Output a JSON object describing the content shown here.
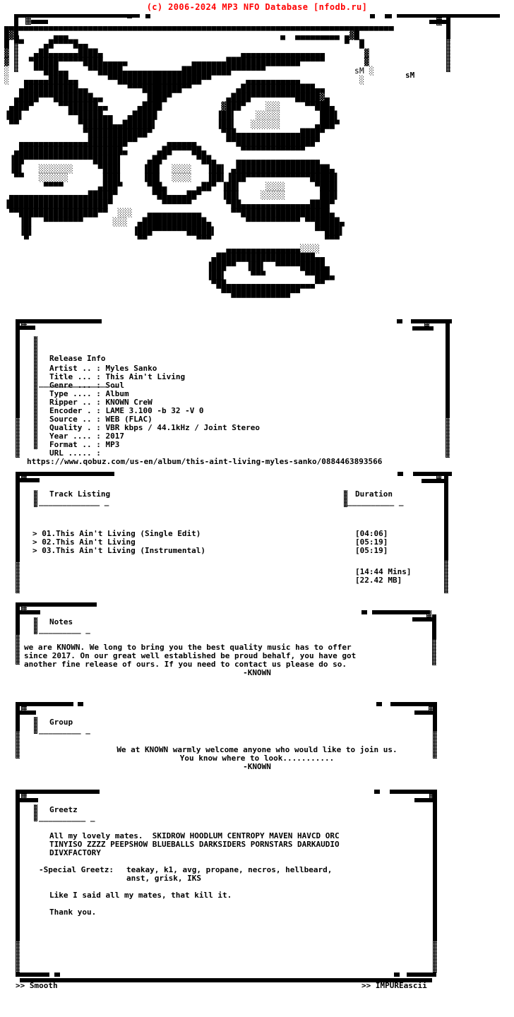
{
  "header": {
    "copyright": "(c) 2006-2024 MP3 NFO Database [nfodb.ru]",
    "color": "#ff0000"
  },
  "logo": {
    "artist_signature": "sM",
    "group_name": "KnoWn",
    "description": "ascii-art-graffiti-logo-known",
    "art": "▄▄▄▄▄▄▄▄▄▄▄▄▄▄▄▄▄▄▄▄▄▄▄▄▄▄▄▄▄▄▄▄▄▄▄▄▄▄▄▄▄▄▄▄▄▄▄▄▄▄▄▄▄▄▄▄▄▄▄▄▄▄▄▄▄▄▄▄▄▄▄▄▄▄▄▄▄▄▄\n█▓▄       ▄▄▄                                           ▄  ▄▄▄▄▄▄▄▄▄ ▄▓█\n█ ▀▀    ▄█▀▀▀▀█▄▄                                                    ▀  █\n▓     ▄██▄▄▄▄▄▄████▄                            ▄▄▄▄▄▄▄▄▄▄▄▄▄▄▄▄▄        ▓\n▓    ▀█████▀▀▀▀▀████▄▄▄▄▄             ▄▄▄▄▄▄▄███████████████▀▀▀▀▀        ▓\n░     ▀▀███▄▄    ▀▀█████▄▄▄▄▄▄▄▄▄▄▄▄██████████▀▀▀▀▀▀▀                  sM ░\n░   ▄▄▄▄▄████▄▄      ▀▀█████████████████▀▀       ▄▄▄▄▄▄▄▄▄▄▄            ░\n   ▄███████████▄▄        ▀▀▀████████▀▀         ▄███████████████▄▄\n  ▄████▀▀▀████████▄▄         ████▀           ▄████▀▀▀▀▀▀▀▀▀█████▓▄\n ▄███▀     ▀▀██████▄▄      ▄████            ▓███▀    ░░░     ▀▀███▄\n▐██▌         ▀▀█████▄▄   ▄█████            ▐██▌    ░░░░░        ███▌\n ▀▀            ▀██████▄▄██████▌            ▐██▌   ░░░░░░       ▄███▀\n                ▀████████████▀              ▀██▄▄▄▄▄▄▄▄▄▄▄▄▄████▀\n   ▄▄▄▄▄▄▄▄▄▄▄▄▄▄████████▀▀      ▄▄▄▄▄▄      ▀▀████████████████▀\n  ▄█████████████████████▄      ▄██▀▀▀▀██▄       ▀▀▀▀▀▀▀▀▀▀▀▀▀\n ▐██▀▀▀▀▀▀▀▀▀▀▀▀▀▀█████▌     ▄██▀      ▀██▄    ▄▄▄▄▄▄▄▄▄▄▄▄▄▄▄▄▄\n ▐█▌   ░░░░░░░     ▀███▌    ▐██▌  ░░░░   ▐██▌ ▄███████████████████▄\n  ▀▀   ░░░░░░       ███▌    ▐██▌  ░░░░   ▐██▌▐███▀▀▀▀▀▀▀▀▀▀▀▀▀█████▌\n        ▀▀▀▀       ▄███▀     ▀██▄      ▄██▀ ▐██▌     ░░░░      ▀███▌\n ▄▄▄▄▄▄▄▄▄▄▄▄▄▄▄▄█████▀       ▀██▄▄▄▄██▀    ▐██▌    ░░░░░       ███▌\n▐████████████████████▀          ▀▀▀▀▀▀       ▀██▄▄▄▄▄▄▄▄▄▄▄▄▄▄████▀\n ▀▀████████████████▀▀  ░░░   ▄▄▄▄▄▄▄▄▄▄▄      ▀▀██████████████████▄\n   ▐█▌  ▀▀▀▀▀▀▀▀      ░░░  ▄█████████████▄       ▀▀▀▀▀▀▀▀▀▀▀ ▀▀█████▄\n   ▐█▌                    ▐███▀▀▀▀▀▀▀█████▌                    ▀▀███▌\n    ▀                      ▀▀          ▀▀▀                       ▀▀▀\n                                             ▄▄▄▄▄▄▄▄▄▄▄▄▄▄▄░░░░\n                                          ▄████████████████████▄▄\n                                         ▐███▀▀  ▐██▌  ▀▀▀▀▀█████▄\n                                         ▐██▌     ▀▀▀        ▀▀███▄\n                                          ▀██▄▄▄▄▄▄▄▄▄▄▄▄▄▄▄▄▄▄▀▀\n                                            ▀▀████████████▀▀"
  },
  "release_info": {
    "title": "Release Info",
    "underline": "_______________ _",
    "fields": [
      {
        "label": "Artist .. :",
        "value": "Myles Sanko"
      },
      {
        "label": "Title ... :",
        "value": "This Ain't Living"
      },
      {
        "label": "Genre ... :",
        "value": "Soul"
      },
      {
        "label": "Type .... :",
        "value": "Album"
      },
      {
        "label": "Ripper .. :",
        "value": "KNOWN CreW"
      },
      {
        "label": "Encoder . :",
        "value": "LAME 3.100 -b 32 -V 0"
      },
      {
        "label": "Source .. :",
        "value": "WEB (FLAC)"
      },
      {
        "label": "Quality . :",
        "value": "VBR kbps / 44.1kHz / Joint Stereo"
      },
      {
        "label": "Year .... :",
        "value": "2017"
      },
      {
        "label": "Format .. :",
        "value": "MP3"
      },
      {
        "label": "URL ..... :",
        "value": ""
      }
    ],
    "url": "https://www.qobuz.com/us-en/album/this-aint-living-myles-sanko/0884463893566"
  },
  "track_listing": {
    "title": "Track Listing",
    "underline": "_____________ _",
    "duration_title": "Duration",
    "duration_underline": "__________ _",
    "tracks": [
      {
        "marker": ">",
        "number": "01.",
        "name": "This Ain't Living (Single Edit)",
        "duration": "[04:06]"
      },
      {
        "marker": ">",
        "number": "02.",
        "name": "This Ain't Living",
        "duration": "[05:19]"
      },
      {
        "marker": ">",
        "number": "03.",
        "name": "This Ain't Living (Instrumental)",
        "duration": "[05:19]"
      }
    ],
    "total_time": "[14:44 Mins]",
    "total_size": "[22.42 MB]"
  },
  "notes": {
    "title": "Notes",
    "underline": "_________ _",
    "lines": [
      "we are KNOWN. We long to bring you the best quality music has to offer",
      "since 2017. On our great well established be proud behalf, you have got",
      "another fine release of ours. If you need to contact us please do so."
    ],
    "signature": "-KNOWN"
  },
  "group": {
    "title": "Group",
    "underline": "_________ _",
    "lines": [
      "We at KNOWN warmly welcome anyone who would like to join us.",
      "You know where to look..........."
    ],
    "signature": "-KNOWN"
  },
  "greetz": {
    "title": "Greetz",
    "underline": "__________ _",
    "mates_intro": "All my lovely mates.  SKIDROW HOODLUM CENTROPY MAVEN HAVCD ORC",
    "mates_line2": "TINYISO ZZZZ PEEPSHOW BLUEBALLS DARKSIDERS PORNSTARS DARKAUDIO",
    "mates_line3": "DIVXFACTORY",
    "special_label": "-Special Greetz:",
    "special_line1": "teakay, k1, avg, propane, necros, hellbeard,",
    "special_line2": "anst, grisk, IKS",
    "closing_line": "Like I said all my mates, that kill it.",
    "thanks": "Thank you."
  },
  "footer": {
    "left": ">> Smooth",
    "right": ">> IMPUREascii"
  }
}
